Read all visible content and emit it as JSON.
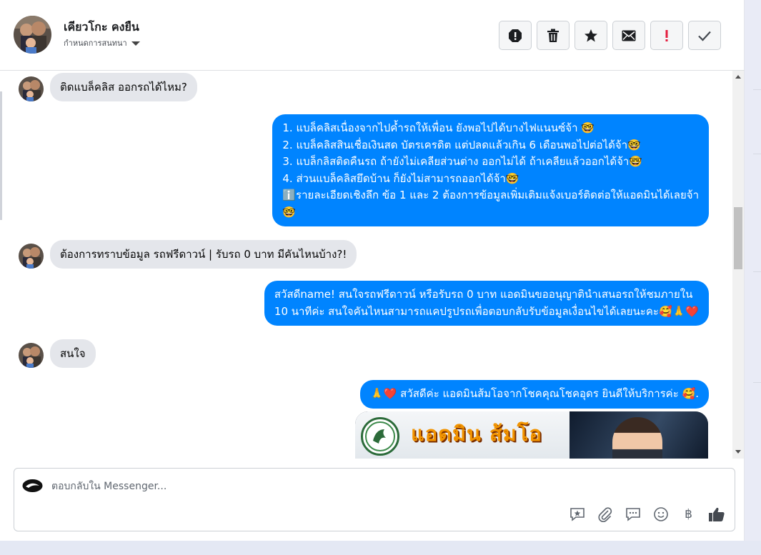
{
  "header": {
    "name": "เคียวโกะ คงยืน",
    "subtitle": "กำหนดการสนทนา",
    "actions": [
      {
        "name": "alert-icon",
        "glyph": "!"
      },
      {
        "name": "trash-icon",
        "glyph": "trash"
      },
      {
        "name": "star-icon",
        "glyph": "★"
      },
      {
        "name": "mail-icon",
        "glyph": "✉"
      },
      {
        "name": "important-icon",
        "glyph": "!"
      },
      {
        "name": "check-icon",
        "glyph": "✓"
      }
    ]
  },
  "messages": [
    {
      "from": "contact",
      "text": "ติดแบล็คลิส ออกรถได้ไหม?"
    },
    {
      "from": "page",
      "lines": [
        "1. แบล็คลิสเนื่องจากไปค้ำรถให้เพื่อน ยังพอไปได้บางไฟแนนซ์จ้า 🤓",
        "2. แบล็คลิสสินเชื่อเงินสด บัตรเครดิต แต่ปลดแล้วเกิน 6 เดือนพอไปต่อได้จ้า🤓",
        "3. แบล็กลิสติดคืนรถ ถ้ายังไม่เคลียส่วนต่าง ออกไม่ได้ ถ้าเคลียแล้วออกได้จ้า🤓",
        "4. ส่วนแบล็คลิสยึดบ้าน ก็ยังไม่สามารถออกได้จ้า🤓",
        "ℹ️รายละเอียดเชิงลึก ข้อ 1 และ 2 ต้องการข้อมูลเพิ่มเติมแจ้งเบอร์ติดต่อให้แอดมินได้เลยจ้า",
        "🤓"
      ]
    },
    {
      "from": "contact",
      "text": "ต้องการทราบข้อมูล รถฟรีดาวน์ | รับรถ 0 บาท มีคันไหนบ้าง?!"
    },
    {
      "from": "page",
      "lines": [
        "สวัสดีname! สนใจรถฟรีดาวน์ หรือรับรถ 0 บาท แอดมินขออนุญาตินำเสนอรถให้ชมภายใน",
        "10 นาทีค่ะ สนใจคันไหนสามารถแคปรูปรถเพื่อตอบกลับรับข้อมูลเงื่อนไขได้เลยนะคะ🥰🙏❤️"
      ]
    },
    {
      "from": "contact",
      "text": "สนใจ"
    },
    {
      "from": "page",
      "lines": [
        "🙏❤️ สวัสดีค่ะ แอดมินส้มโอจากโชคคุณโชคอุดร ยินดีให้บริการค่ะ  🥰."
      ]
    }
  ],
  "image_card": {
    "title": "แอดมิน ส้มโอ"
  },
  "composer": {
    "placeholder": "ตอบกลับใน Messenger...",
    "tools": [
      {
        "name": "saved-reply-icon"
      },
      {
        "name": "attach-icon"
      },
      {
        "name": "chat-icon"
      },
      {
        "name": "emoji-icon"
      },
      {
        "name": "baht-icon",
        "glyph": "฿"
      },
      {
        "name": "like-icon"
      }
    ]
  },
  "colors": {
    "outgoing_bubble": "#0084ff",
    "incoming_bubble": "#e4e6eb",
    "important": "#e41e3f"
  }
}
